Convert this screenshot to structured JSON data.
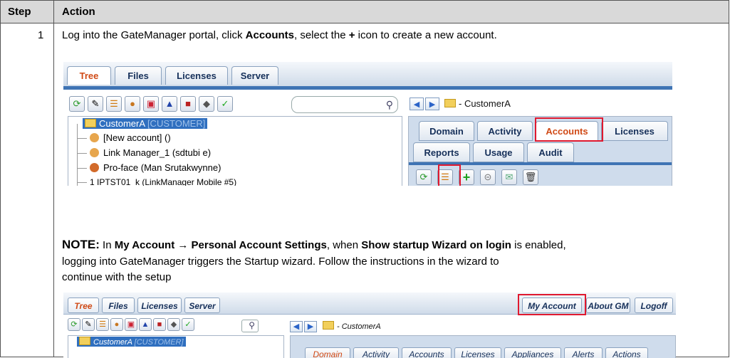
{
  "table": {
    "header_step": "Step",
    "header_action": "Action",
    "row_number": "1"
  },
  "step": {
    "pre": "Log into the GateManager portal, click ",
    "accounts_word": "Accounts",
    "mid": ", select the ",
    "plus": "+",
    "post": " icon to create a new account."
  },
  "note": {
    "label": "NOTE:",
    "t1": " In ",
    "my_account_path": "My Account → Personal Account Settings",
    "t2": ", when ",
    "setting": "Show startup Wizard on login",
    "t3": " is enabled,",
    "line2": "logging into GateManager triggers the Startup wizard. Follow the instructions in the wizard to",
    "line3": "continue with the setup"
  },
  "shot1": {
    "tabs": [
      "Tree",
      "Files",
      "Licenses",
      "Server"
    ],
    "breadcrumb": "- CustomerA",
    "tree": {
      "root_name": "CustomerA",
      "root_type": "[CUSTOMER]",
      "items": [
        "[New account] ()",
        "Link Manager_1 (sdtubi e)",
        "Pro-face (Man Srutakwynne)",
        "1 IPTST01_k (LinkManager Mobile #5)"
      ]
    },
    "panel_tabs_row1": [
      "Domain",
      "Activity",
      "Accounts",
      "Licenses"
    ],
    "panel_tabs_row2": [
      "Reports",
      "Usage",
      "Audit"
    ]
  },
  "shot2": {
    "tabs": [
      "Tree",
      "Files",
      "Licenses",
      "Server"
    ],
    "right_tabs": [
      "My Account",
      "About GM",
      "Logoff"
    ],
    "breadcrumb": "- CustomerA",
    "tree_root_name": "CustomerA",
    "tree_root_type": "[CUSTOMER]",
    "panel_tabs": [
      "Domain",
      "Activity",
      "Accounts",
      "Licenses",
      "Appliances",
      "Alerts",
      "Actions"
    ]
  },
  "colors": {
    "accent_red": "#e0192f",
    "tab_blue": "#3f74b4",
    "active_tab_text": "#d04a16"
  }
}
